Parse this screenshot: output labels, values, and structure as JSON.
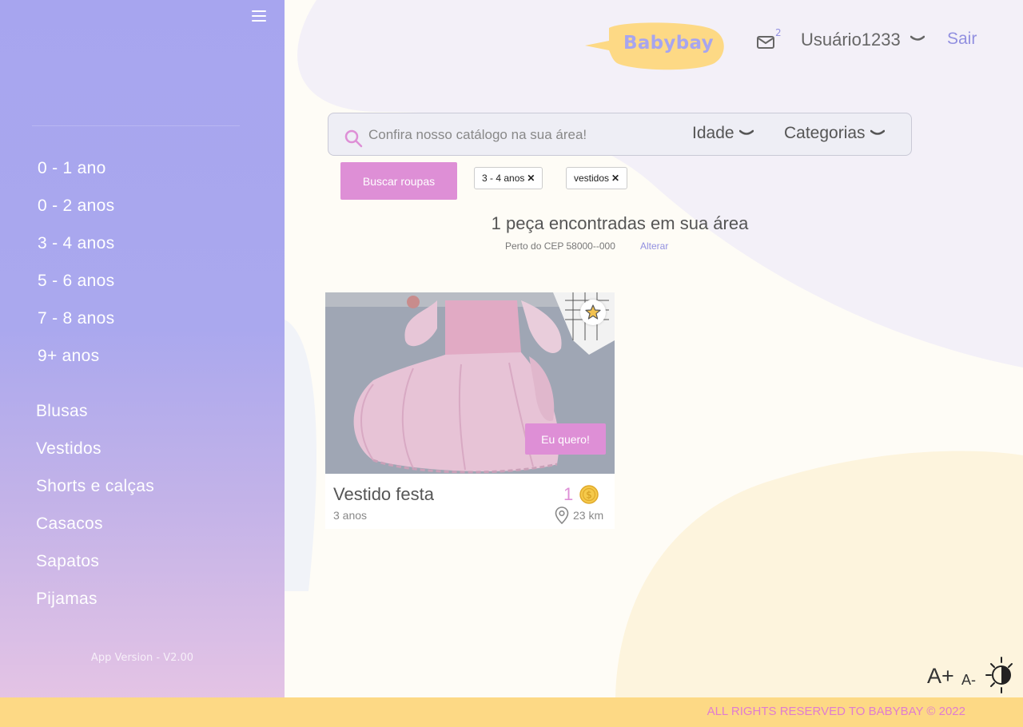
{
  "sidebar": {
    "age_filters": [
      "0 - 1 ano",
      "0 - 2 anos",
      "3 - 4 anos",
      "5 - 6 anos",
      "7 - 8 anos",
      "9+ anos"
    ],
    "category_filters": [
      "Blusas",
      "Vestidos",
      "Shorts e calças",
      "Casacos",
      "Sapatos",
      "Pijamas"
    ],
    "app_version": "App Version - V2.00"
  },
  "header": {
    "logo_text": "Babybay",
    "mail_count": "2",
    "username": "Usuário1233",
    "logout_label": "Sair"
  },
  "search": {
    "placeholder": "Confira nosso catálogo na sua área!",
    "age_dropdown": "Idade",
    "category_dropdown": "Categorias",
    "button_label": "Buscar roupas",
    "active_filters": [
      "3 - 4 anos",
      "vestidos"
    ]
  },
  "results": {
    "title": "1 peça encontradas em sua área",
    "near_text": "Perto do CEP 58000--000",
    "change_label": "Alterar"
  },
  "items": [
    {
      "title": "Vestido festa",
      "age": "3 anos",
      "price": "1",
      "distance": "23 km",
      "action_label": "Eu quero!"
    }
  ],
  "accessibility": {
    "increase_font": "A+",
    "decrease_font": "A-"
  },
  "footer": {
    "text": "ALL RIGHTS RESERVED TO BABYBAY © 2022"
  },
  "colors": {
    "sidebar": "#a7a5ef",
    "accent_pink": "#de8fd6",
    "accent_purple": "#9290e0",
    "footer": "#fdd985"
  }
}
